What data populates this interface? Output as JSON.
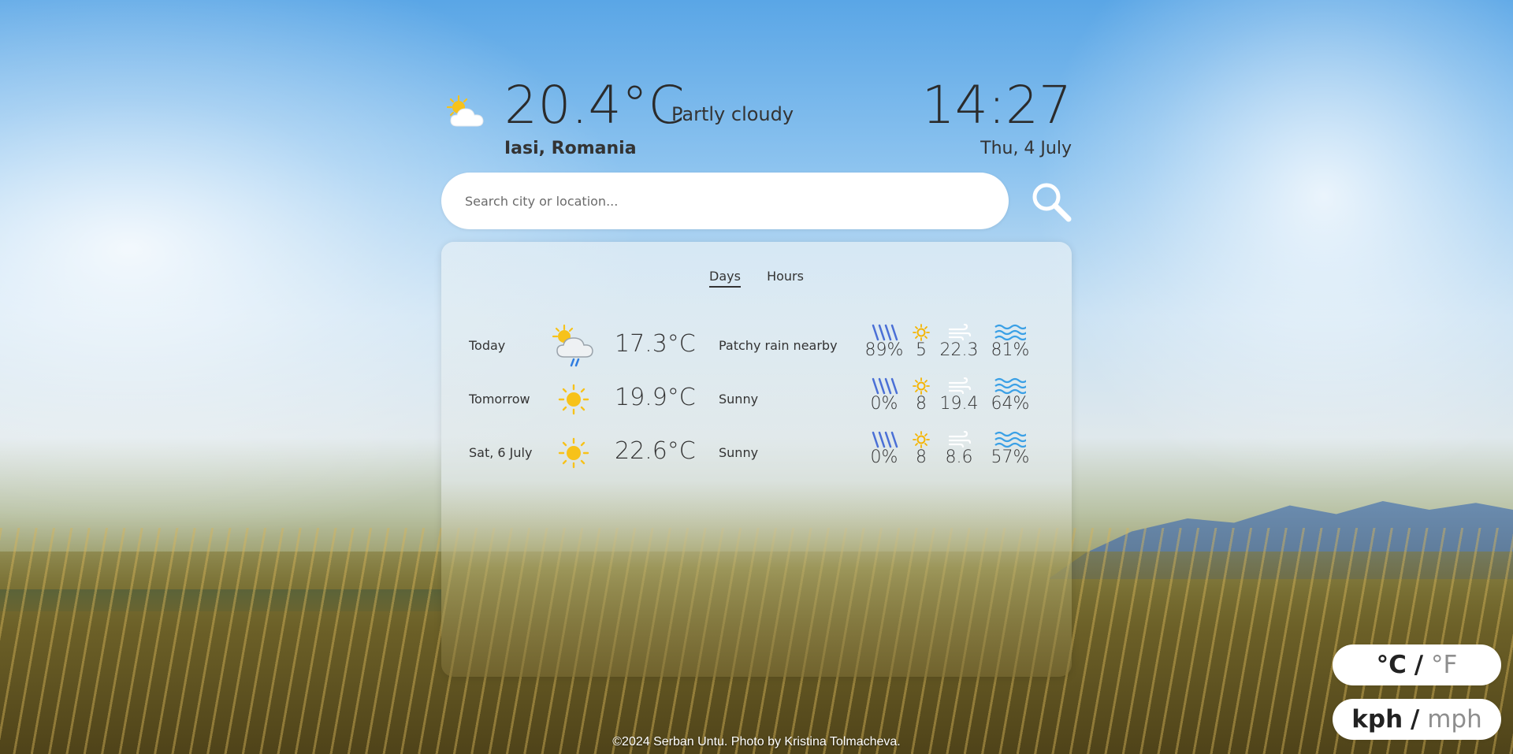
{
  "current": {
    "icon": "partly-cloudy-icon",
    "temperature": "20.4°C",
    "condition": "Partly cloudy",
    "location": "Iasi, Romania"
  },
  "clock": {
    "time": "14:27",
    "date": "Thu, 4 July"
  },
  "search": {
    "placeholder": "Search city or location...",
    "value": "",
    "button_icon": "search-icon"
  },
  "tabs": [
    {
      "label": "Days",
      "active": true
    },
    {
      "label": "Hours",
      "active": false
    }
  ],
  "forecast": [
    {
      "day": "Today",
      "icon": "patchy-rain-icon",
      "temperature": "17.3°C",
      "condition": "Patchy rain nearby",
      "rain": "89%",
      "uv": "5",
      "wind": "22.3",
      "humidity": "81%"
    },
    {
      "day": "Tomorrow",
      "icon": "sun-icon",
      "temperature": "19.9°C",
      "condition": "Sunny",
      "rain": "0%",
      "uv": "8",
      "wind": "19.4",
      "humidity": "64%"
    },
    {
      "day": "Sat, 6 July",
      "icon": "sun-icon",
      "temperature": "22.6°C",
      "condition": "Sunny",
      "rain": "0%",
      "uv": "8",
      "wind": "8.6",
      "humidity": "57%"
    }
  ],
  "units": {
    "temperature": {
      "primary": "°C",
      "separator": "/",
      "secondary": "°F"
    },
    "speed": {
      "primary": "kph",
      "separator": "/",
      "secondary": "mph"
    }
  },
  "footer": "©2024 Serban Untu. Photo by Kristina Tolmacheva.",
  "colors": {
    "rain_icon": "#4a6fd6",
    "uv_icon": "#f5b400",
    "wind_icon": "#ffffff",
    "humidity_icon": "#3aa0e6",
    "sun": "#f7c21a"
  }
}
